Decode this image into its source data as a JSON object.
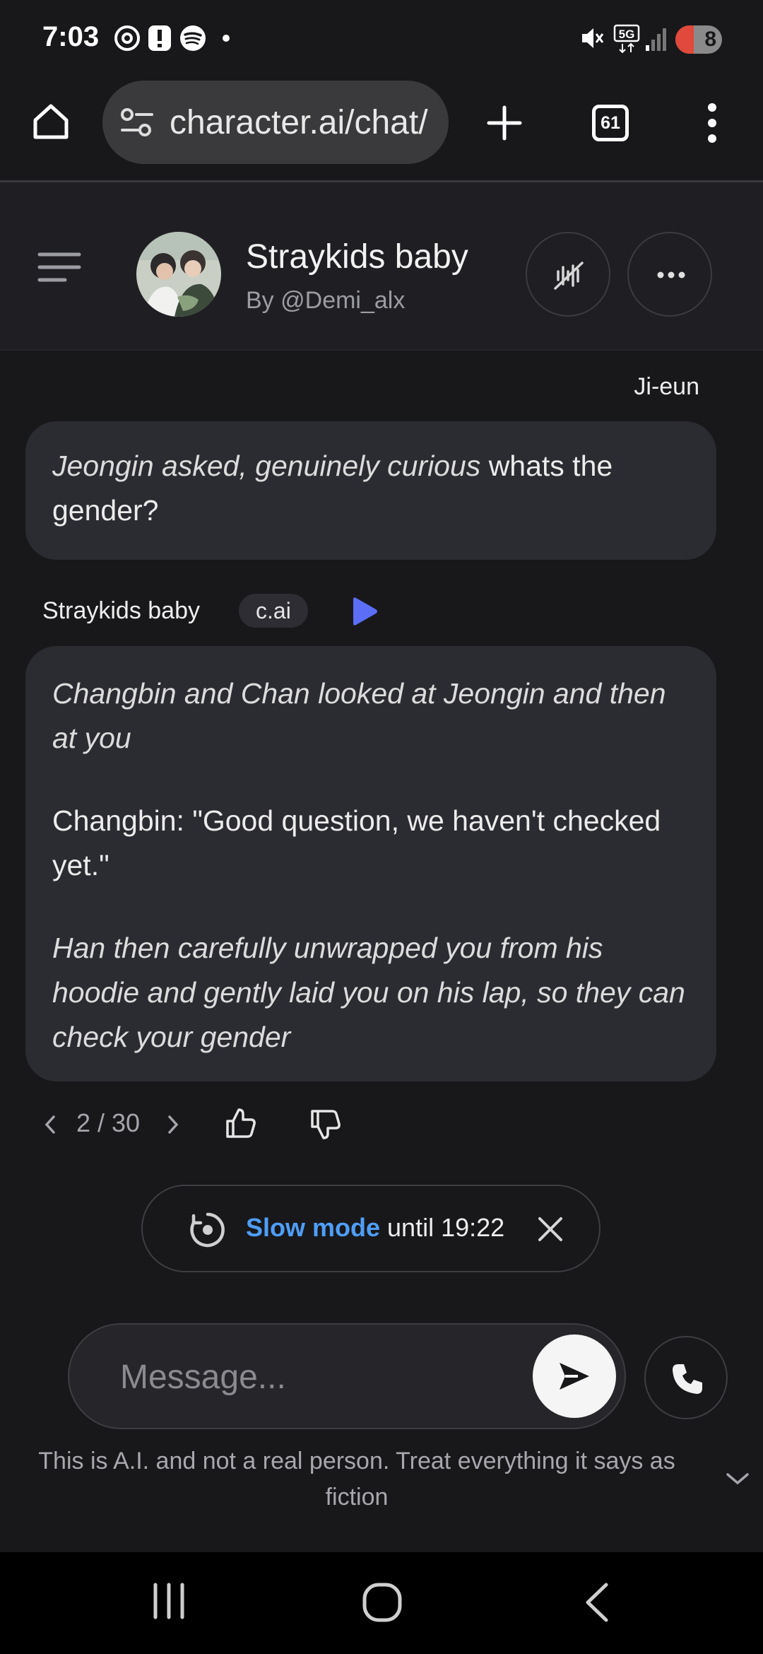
{
  "status_bar": {
    "time": "7:03",
    "network": "5G",
    "battery": "8"
  },
  "browser": {
    "url": "character.ai/chat/",
    "tab_count": "61"
  },
  "chat_header": {
    "character_name": "Straykids baby",
    "creator": "By @Demi_alx"
  },
  "messages": {
    "user_name": "Ji-eun",
    "user_message": {
      "italic": "Jeongin asked, genuinely curious",
      "plain": " whats the gender?"
    },
    "bot_name": "Straykids baby",
    "bot_tag": "c.ai",
    "bot_message": {
      "para1": "Changbin and Chan looked at Jeongin and then at you",
      "para2": "Changbin: \"Good question, we haven't checked yet.\"",
      "para3": "Han then carefully unwrapped you from his hoodie and gently laid you on his lap, so they can check your gender"
    },
    "pager": "2 / 30"
  },
  "slow_mode": {
    "label": "Slow mode",
    "until": " until 19:22"
  },
  "composer": {
    "placeholder": "Message..."
  },
  "disclaimer": "This is A.I. and not a real person. Treat everything it says as fiction",
  "colors": {
    "accent_blue": "#4f9ef6",
    "play_blue": "#5b6ef5",
    "background": "#18181b",
    "bubble": "#2b2c31"
  }
}
